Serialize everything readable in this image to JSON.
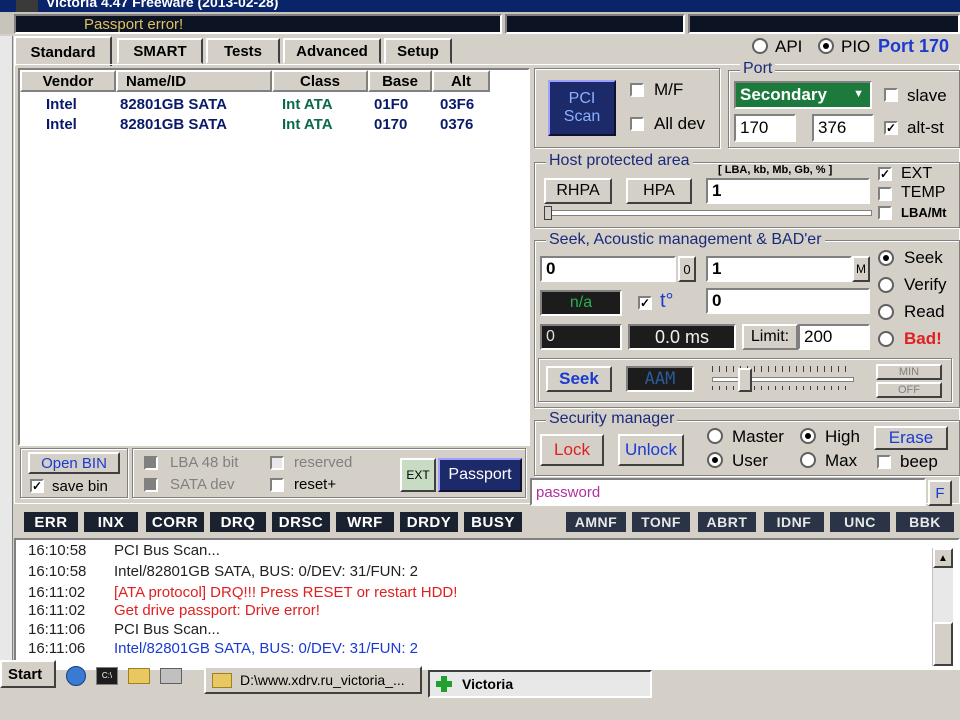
{
  "title_bar": {
    "text": "Victoria 4.47 Freeware (2013-02-28)"
  },
  "status": {
    "passport_error": "Passport error!"
  },
  "tabs": [
    "Standard",
    "SMART",
    "Tests",
    "Advanced",
    "Setup"
  ],
  "mode": {
    "api": "API",
    "pio": "PIO",
    "port_label": "Port 170"
  },
  "device_table": {
    "headers": [
      "Vendor",
      "Name/ID",
      "Class",
      "Base",
      "Alt"
    ],
    "rows": [
      {
        "vendor": "Intel",
        "name": "82801GB SATA",
        "class": "Int ATA",
        "base": "01F0",
        "alt": "03F6"
      },
      {
        "vendor": "Intel",
        "name": "82801GB SATA",
        "class": "Int ATA",
        "base": "0170",
        "alt": "0376"
      }
    ]
  },
  "pci": {
    "scan_label": "PCI Scan",
    "mf": "M/F",
    "all_dev": "All dev"
  },
  "port": {
    "title": "Port",
    "select": "Secondary",
    "base": "170",
    "alt": "376",
    "slave": "slave",
    "alt_st": "alt-st"
  },
  "hpa": {
    "title": "Host protected area",
    "units": "[ LBA, kb, Mb, Gb, % ]",
    "rhpa": "RHPA",
    "hpa": "HPA",
    "value": "1",
    "ext": "EXT",
    "temp": "TEMP",
    "lba_mt": "LBA/Mt"
  },
  "seek": {
    "title": "Seek, Acoustic management & BAD'er",
    "from": "0",
    "from_unit": "0",
    "to": "1",
    "to_unit": "M",
    "na": "n/a",
    "temp_symbol": "t°",
    "temp_value": "0",
    "counter": "0",
    "ms": "0.0 ms",
    "limit_label": "Limit:",
    "limit_value": "200",
    "modes": [
      "Seek",
      "Verify",
      "Read",
      "Bad!"
    ],
    "seek_btn": "Seek",
    "aam": "AAM",
    "min": "MIN",
    "off": "OFF"
  },
  "security": {
    "title": "Security manager",
    "lock": "Lock",
    "unlock": "Unlock",
    "master": "Master",
    "high": "High",
    "erase": "Erase",
    "user": "User",
    "max": "Max",
    "beep": "beep"
  },
  "password": {
    "value": "password",
    "f_btn": "F"
  },
  "bottom_left": {
    "open_bin": "Open BIN",
    "save_bin": "save bin",
    "lba48": "LBA 48 bit",
    "sata_dev": "SATA dev",
    "reserved": "reserved",
    "reset_plus": "reset+",
    "ext": "EXT",
    "passport": "Passport"
  },
  "flags_left": [
    "ERR",
    "INX",
    "CORR",
    "DRQ",
    "DRSC",
    "WRF",
    "DRDY",
    "BUSY"
  ],
  "flags_right": [
    "AMNF",
    "TONF",
    "ABRT",
    "IDNF",
    "UNC",
    "BBK"
  ],
  "log": [
    {
      "time": "16:10:58",
      "text": "PCI Bus Scan...",
      "color": "#222222"
    },
    {
      "time": "16:10:58",
      "text": "Intel/82801GB SATA, BUS: 0/DEV: 31/FUN: 2",
      "color": "#222222"
    },
    {
      "time": "16:11:02",
      "text": "[ATA protocol] DRQ!!! Press RESET or restart HDD!",
      "color": "#e02020"
    },
    {
      "time": "16:11:02",
      "text": "Get drive passport: Drive error!",
      "color": "#e02020"
    },
    {
      "time": "16:11:06",
      "text": "PCI Bus Scan...",
      "color": "#222222"
    },
    {
      "time": "16:11:06",
      "text": "Intel/82801GB SATA, BUS: 0/DEV: 31/FUN: 2",
      "color": "#1a3ad0"
    }
  ],
  "taskbar": {
    "start": "Start",
    "explorer_item": "D:\\www.xdrv.ru_victoria_...",
    "victoria_item": "Victoria"
  }
}
